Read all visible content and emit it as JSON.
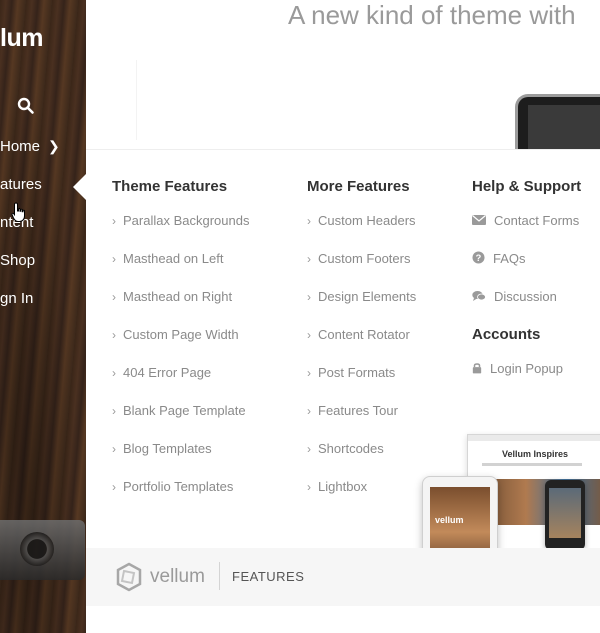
{
  "masthead": {
    "logo": "lum",
    "nav": [
      {
        "label": "Home",
        "has_chevron": true
      },
      {
        "label": "atures"
      },
      {
        "label": "ntent"
      },
      {
        "label": "Shop"
      },
      {
        "label": "gn In"
      }
    ]
  },
  "hero": {
    "headline": "A new kind of theme with"
  },
  "menu": {
    "col1": {
      "title": "Theme Features",
      "links": [
        "Parallax Backgrounds",
        "Masthead on Left",
        "Masthead on Right",
        "Custom Page Width",
        "404 Error Page",
        "Blank Page Template",
        "Blog Templates",
        "Portfolio Templates"
      ]
    },
    "col2": {
      "title": "More Features",
      "links": [
        "Custom Headers",
        "Custom Footers",
        "Design Elements",
        "Content Rotator",
        "Post Formats",
        "Features Tour",
        "Shortcodes",
        "Lightbox"
      ]
    },
    "col3": {
      "title": "Help & Support",
      "links": [
        {
          "label": "Contact Forms",
          "icon": "envelope-icon"
        },
        {
          "label": "FAQs",
          "icon": "question-circle-icon"
        },
        {
          "label": "Discussion",
          "icon": "comments-icon"
        }
      ],
      "accounts_title": "Accounts",
      "accounts_links": [
        {
          "label": "Login Popup",
          "icon": "lock-icon"
        }
      ]
    },
    "footer": {
      "brand": "vellum",
      "section": "FEATURES"
    },
    "illustration": {
      "monitor_title": "Vellum Inspires",
      "tablet_logo": "vellum"
    }
  },
  "colors": {
    "accent": "#f3b21b",
    "text_muted": "#8a8a8a",
    "heading": "#333333"
  }
}
